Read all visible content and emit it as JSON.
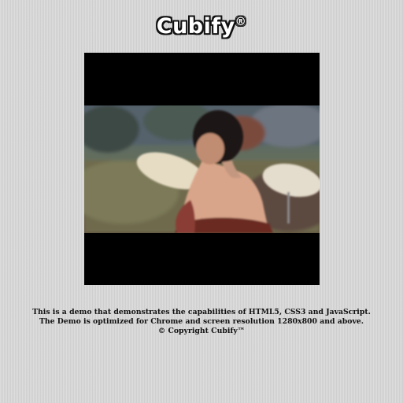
{
  "logo": {
    "text": "Cubify",
    "mark": "®"
  },
  "player": {
    "icon": "video-frame-icon"
  },
  "footer": {
    "line1": "This is a demo that demonstrates the capabilities of HTML5, CSS3 and JavaScript.",
    "line2": "The Demo is optimized for Chrome and screen resolution 1280x800 and above.",
    "line3": "© Copyright Cubify™"
  }
}
